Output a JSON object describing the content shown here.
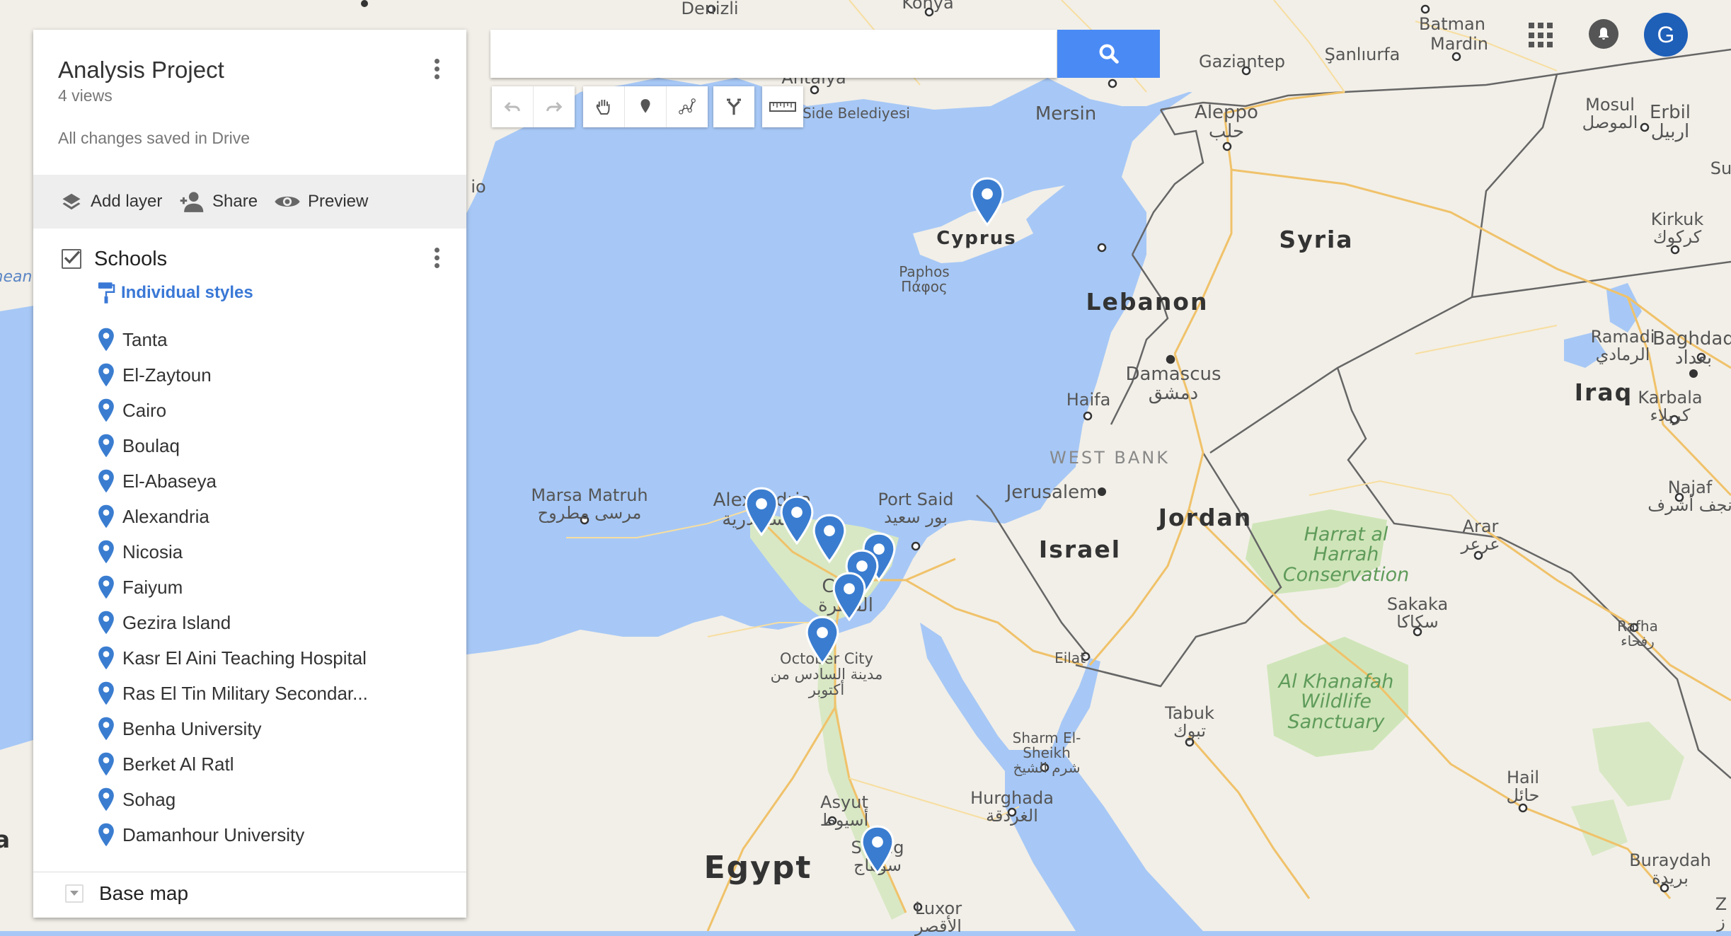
{
  "project": {
    "title": "Analysis Project",
    "views": "4 views",
    "saved_status": "All changes saved in Drive"
  },
  "actions": {
    "add_layer": "Add layer",
    "share": "Share",
    "preview": "Preview"
  },
  "layer": {
    "name": "Schools",
    "checked": true,
    "style_label": "Individual styles",
    "items": [
      "Tanta",
      "El-Zaytoun",
      "Cairo",
      "Boulaq",
      "El-Abaseya",
      "Alexandria",
      "Nicosia",
      "Faiyum",
      "Gezira Island",
      "Kasr El Aini Teaching Hospital",
      "Ras El Tin Military Secondar...",
      "Benha University",
      "Berket Al Ratl",
      "Sohag",
      "Damanhour University"
    ]
  },
  "base_map": {
    "label": "Base map"
  },
  "search": {
    "value": "",
    "placeholder": ""
  },
  "account": {
    "avatar_letter": "G"
  },
  "colors": {
    "accent": "#4a8af4",
    "pin": "#3a7dd0",
    "water": "#a7c8f6",
    "land": "#f2efe8",
    "park": "#cfe5b9",
    "avatar": "#1e5fb8"
  },
  "map_labels": {
    "denizli": "Denizli",
    "konya": "Konya",
    "batman": "Batman",
    "mardin": "Mardin",
    "gaziantep": "Gaziantep",
    "sanliurfa": "Şanlıurfa",
    "antalya": "Antalya",
    "side": "Side Belediyesi",
    "mersin": "Mersin",
    "aleppo": "Aleppo",
    "aleppo_ar": "حلب",
    "mosul": "Mosul",
    "mosul_ar": "الموصل",
    "erbil": "Erbil",
    "erbil_ar": "اربيل",
    "su": "Su",
    "kirkuk": "Kirkuk",
    "kirkuk_ar": "كركوك",
    "cyprus": "Cyprus",
    "paphos": "Paphos",
    "paphos_gr": "Πάφος",
    "syria": "Syria",
    "lebanon": "Lebanon",
    "ramadi": "Ramadi",
    "ramadi_ar": "الرمادي",
    "baghdad": "Baghdad",
    "baghdad_ar": "بغداد",
    "damascus": "Damascus",
    "damascus_ar": "دمشق",
    "haifa": "Haifa",
    "iraq": "Iraq",
    "karbala": "Karbala",
    "karbala_ar": "كربلاء",
    "west_bank": "WEST BANK",
    "najaf": "Najaf",
    "najaf_ar": "نجف أشرف",
    "jerusalem": "Jerusalem",
    "marsa": "Marsa Matruh",
    "marsa_ar": "مرسى مطروح",
    "alexandria": "Alexandria",
    "alexandria_ar": "الإسكندرية",
    "port_said": "Port Said",
    "port_said_ar": "بور سعيد",
    "jordan": "Jordan",
    "israel": "Israel",
    "harrat": "Harrat al Harrah Conservation",
    "arar": "Arar",
    "arar_ar": "عرعر",
    "cairo": "Cairo",
    "cairo_ar": "القاهرة",
    "sakaka": "Sakaka",
    "sakaka_ar": "سكاكا",
    "rafha": "Rafha",
    "rafha_ar": "رفحاء",
    "october": "October City",
    "october_ar": "مدينة السادس من أكتوبر",
    "eilat": "Eilat",
    "khanafah": "Al Khanafah Wildlife Sanctuary",
    "tabuk": "Tabuk",
    "tabuk_ar": "تبوك",
    "sharm": "Sharm El-Sheikh",
    "sharm_ar": "شرم الشيخ",
    "hail": "Hail",
    "hail_ar": "حائل",
    "asyut": "Asyut",
    "asyut_ar": "أسيوط",
    "hurghada": "Hurghada",
    "hurghada_ar": "الغردقة",
    "sohag": "Sohag",
    "sohag_ar": "سوهاج",
    "egypt": "Egypt",
    "buraydah": "Buraydah",
    "buraydah_ar": "بريدة",
    "luxor": "Luxor",
    "luxor_ar": "الأقصر",
    "iraq_z": "Z",
    "iraq_z_ar": "ز",
    "sea_fragment": "nean",
    "io_fragment": "io",
    "a_fragment": "a"
  }
}
